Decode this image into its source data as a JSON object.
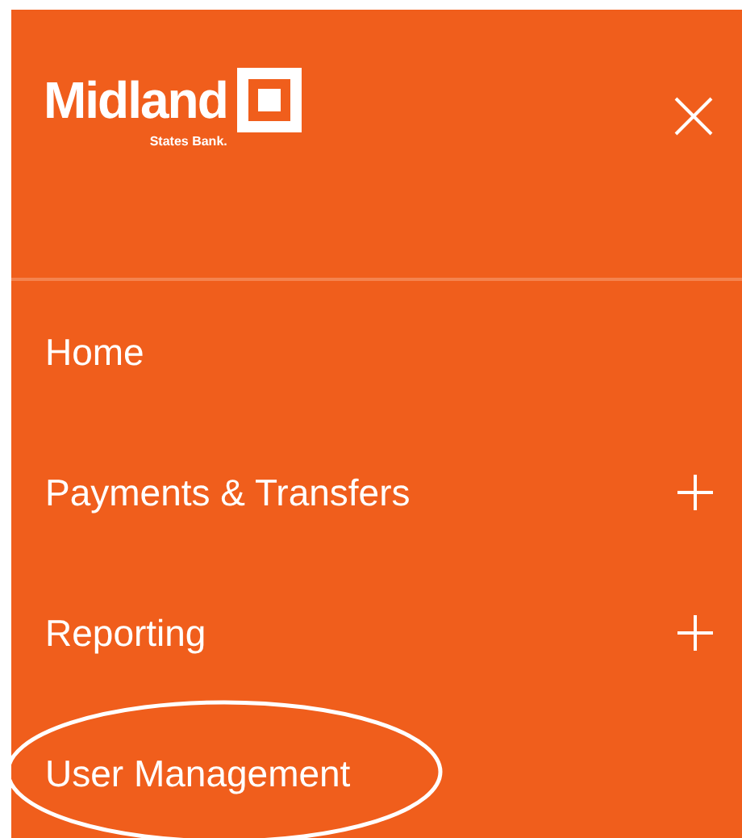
{
  "logo": {
    "name": "Midland",
    "subtitle": "States Bank."
  },
  "menu": [
    {
      "label": "Home",
      "expandable": false,
      "highlighted": false
    },
    {
      "label": "Payments & Transfers",
      "expandable": true,
      "highlighted": false
    },
    {
      "label": "Reporting",
      "expandable": true,
      "highlighted": false
    },
    {
      "label": "User Management",
      "expandable": false,
      "highlighted": true
    }
  ]
}
